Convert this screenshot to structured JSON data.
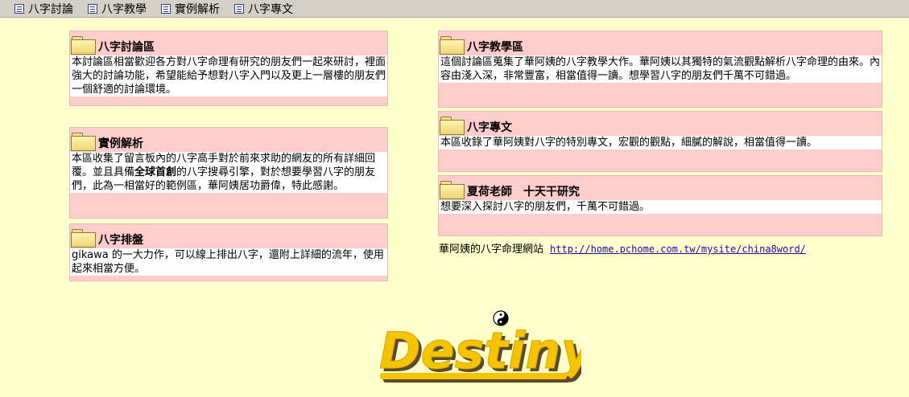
{
  "nav": {
    "items": [
      {
        "label": "八字討論",
        "icon": "page-icon"
      },
      {
        "label": "八字教學",
        "icon": "page-icon"
      },
      {
        "label": "實例解析",
        "icon": "page-icon"
      },
      {
        "label": "八字專文",
        "icon": "page-icon"
      }
    ]
  },
  "panels": {
    "discussion": {
      "title": "八字討論區",
      "desc": "本討論區相當歡迎各方對八字命理有研究的朋友們一起來研討，裡面強大的討論功能，希望能給予想對八字入門以及更上一層樓的朋友們一個舒適的討論環境。"
    },
    "examples": {
      "title": "實例解析",
      "desc_a": "本區收集了留言板內的八字高手對於前來求助的網友的所有詳細回覆。並且具備",
      "desc_bold": "全球首創",
      "desc_b": "的八字搜尋引擎，對於想要學習八字的朋友們，此為一相當好的範例區，華阿姨居功爵偉，特此感謝。"
    },
    "chart": {
      "title": "八字排盤",
      "desc": "gikawa 的一大力作，可以線上排出八字，還附上詳細的流年，使用起來相當方便。"
    },
    "teaching": {
      "title": "八字教學區",
      "desc": "這個討論區蒐集了華阿姨的八字教學大作。華阿姨以其獨特的氣流觀點解析八字命理的由來。內容由淺入深，非常豐富，相當值得一讀。想學習八字的朋友們千萬不可錯過。"
    },
    "articles": {
      "title": "八字專文",
      "desc": "本區收錄了華阿姨對八字的特別專文，宏觀的觀點，細膩的解說，相當值得一讀。"
    },
    "research": {
      "title": "夏荷老師　十天干研究",
      "desc": "想要深入探討八字的朋友們，千萬不可錯過。"
    }
  },
  "site": {
    "label": "華阿姨的八字命理網站",
    "url": "http://home.pchome.com.tw/mysite/china8word/"
  },
  "logo": {
    "text": "Destiny",
    "icon": "yin-yang-icon",
    "colors": {
      "fill": "#f5c300",
      "shadow": "#5a4a2a"
    }
  },
  "colors": {
    "background": "#ffffcc",
    "panel": "#ffcccc",
    "toolbar": "#d4d0c8",
    "link": "#1a0dab"
  }
}
